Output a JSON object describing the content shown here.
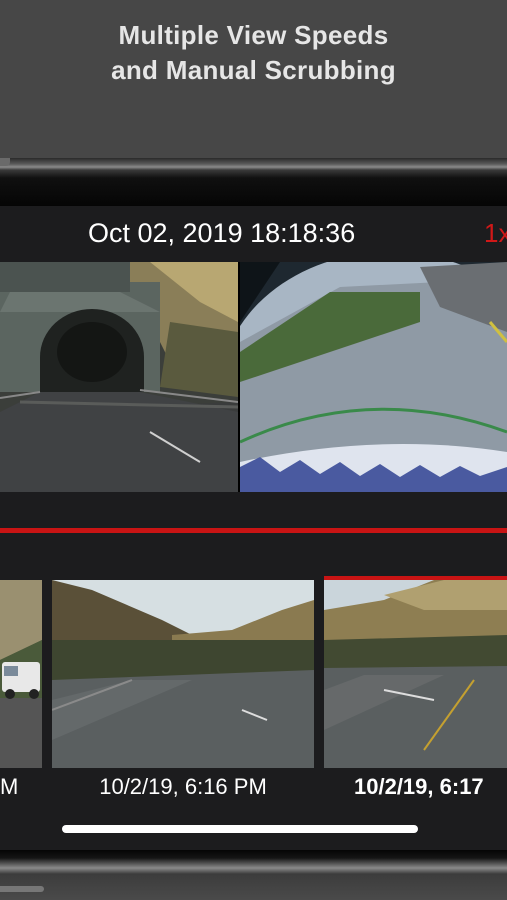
{
  "promo": {
    "title_line1": "Multiple View Speeds",
    "title_line2": "and Manual Scrubbing"
  },
  "player": {
    "timestamp": "Oct 02, 2019 18:18:36",
    "speed": "1x",
    "cameras": {
      "front": "front-camera-view",
      "rear": "rear-fisheye-camera-view"
    },
    "accent_color": "#c81414"
  },
  "timeline": {
    "clips": [
      {
        "label": "M"
      },
      {
        "label": "10/2/19, 6:16 PM"
      },
      {
        "label": "10/2/19, 6:17"
      }
    ]
  }
}
